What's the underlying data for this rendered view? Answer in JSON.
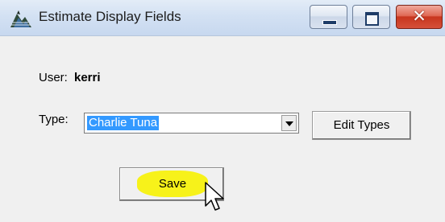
{
  "window": {
    "title": "Estimate Display Fields",
    "controls": {
      "minimize": "minimize",
      "maximize": "maximize",
      "close": "close"
    }
  },
  "form": {
    "user_label": "User:",
    "user_value": "kerri",
    "type_label": "Type:",
    "type_value": "Charlie Tuna",
    "edit_types_label": "Edit Types",
    "save_label": "Save"
  },
  "colors": {
    "selection": "#3399ff",
    "highlight": "#f7f21a",
    "close_button": "#d5503a"
  },
  "icons": [
    "app-logo-icon",
    "minimize-icon",
    "maximize-icon",
    "close-icon",
    "dropdown-arrow-icon",
    "mouse-pointer-icon"
  ]
}
